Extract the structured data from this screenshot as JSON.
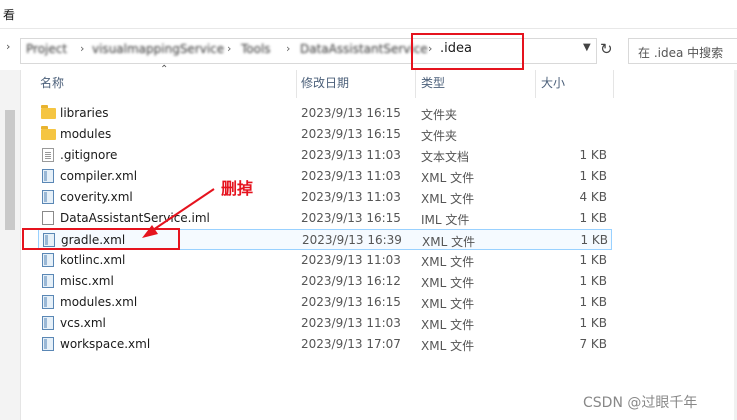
{
  "menu": {
    "view_label": "看"
  },
  "address": {
    "crumbs": [
      "Project",
      "visualmappingService",
      "Tools",
      "DataAssistantService"
    ],
    "current_folder": ".idea",
    "dropdown_icon": "chevron-down-icon",
    "refresh_icon": "refresh-icon"
  },
  "search": {
    "placeholder": "在 .idea 中搜索"
  },
  "columns": {
    "name": "名称",
    "date": "修改日期",
    "type": "类型",
    "size": "大小"
  },
  "files": [
    {
      "name": "libraries",
      "date": "2023/9/13 16:15",
      "type": "文件夹",
      "size": "",
      "icon": "folder-icon"
    },
    {
      "name": "modules",
      "date": "2023/9/13 16:15",
      "type": "文件夹",
      "size": "",
      "icon": "folder-icon"
    },
    {
      "name": ".gitignore",
      "date": "2023/9/13 11:03",
      "type": "文本文档",
      "size": "1 KB",
      "icon": "text-file-icon"
    },
    {
      "name": "compiler.xml",
      "date": "2023/9/13 11:03",
      "type": "XML 文件",
      "size": "1 KB",
      "icon": "xml-file-icon"
    },
    {
      "name": "coverity.xml",
      "date": "2023/9/13 11:03",
      "type": "XML 文件",
      "size": "4 KB",
      "icon": "xml-file-icon"
    },
    {
      "name": "DataAssistantService.iml",
      "date": "2023/9/13 16:15",
      "type": "IML 文件",
      "size": "1 KB",
      "icon": "iml-file-icon"
    },
    {
      "name": "gradle.xml",
      "date": "2023/9/13 16:39",
      "type": "XML 文件",
      "size": "1 KB",
      "icon": "xml-file-icon"
    },
    {
      "name": "kotlinc.xml",
      "date": "2023/9/13 11:03",
      "type": "XML 文件",
      "size": "1 KB",
      "icon": "xml-file-icon"
    },
    {
      "name": "misc.xml",
      "date": "2023/9/13 16:12",
      "type": "XML 文件",
      "size": "1 KB",
      "icon": "xml-file-icon"
    },
    {
      "name": "modules.xml",
      "date": "2023/9/13 16:15",
      "type": "XML 文件",
      "size": "1 KB",
      "icon": "xml-file-icon"
    },
    {
      "name": "vcs.xml",
      "date": "2023/9/13 11:03",
      "type": "XML 文件",
      "size": "1 KB",
      "icon": "xml-file-icon"
    },
    {
      "name": "workspace.xml",
      "date": "2023/9/13 17:07",
      "type": "XML 文件",
      "size": "7 KB",
      "icon": "xml-file-icon"
    }
  ],
  "annotation": {
    "text": "删掉",
    "color": "#e5131e"
  },
  "watermark": "CSDN @过眼千年",
  "colors": {
    "selection_border": "#99d1ff",
    "header_text": "#4c607a",
    "highlight": "#e5131e"
  }
}
